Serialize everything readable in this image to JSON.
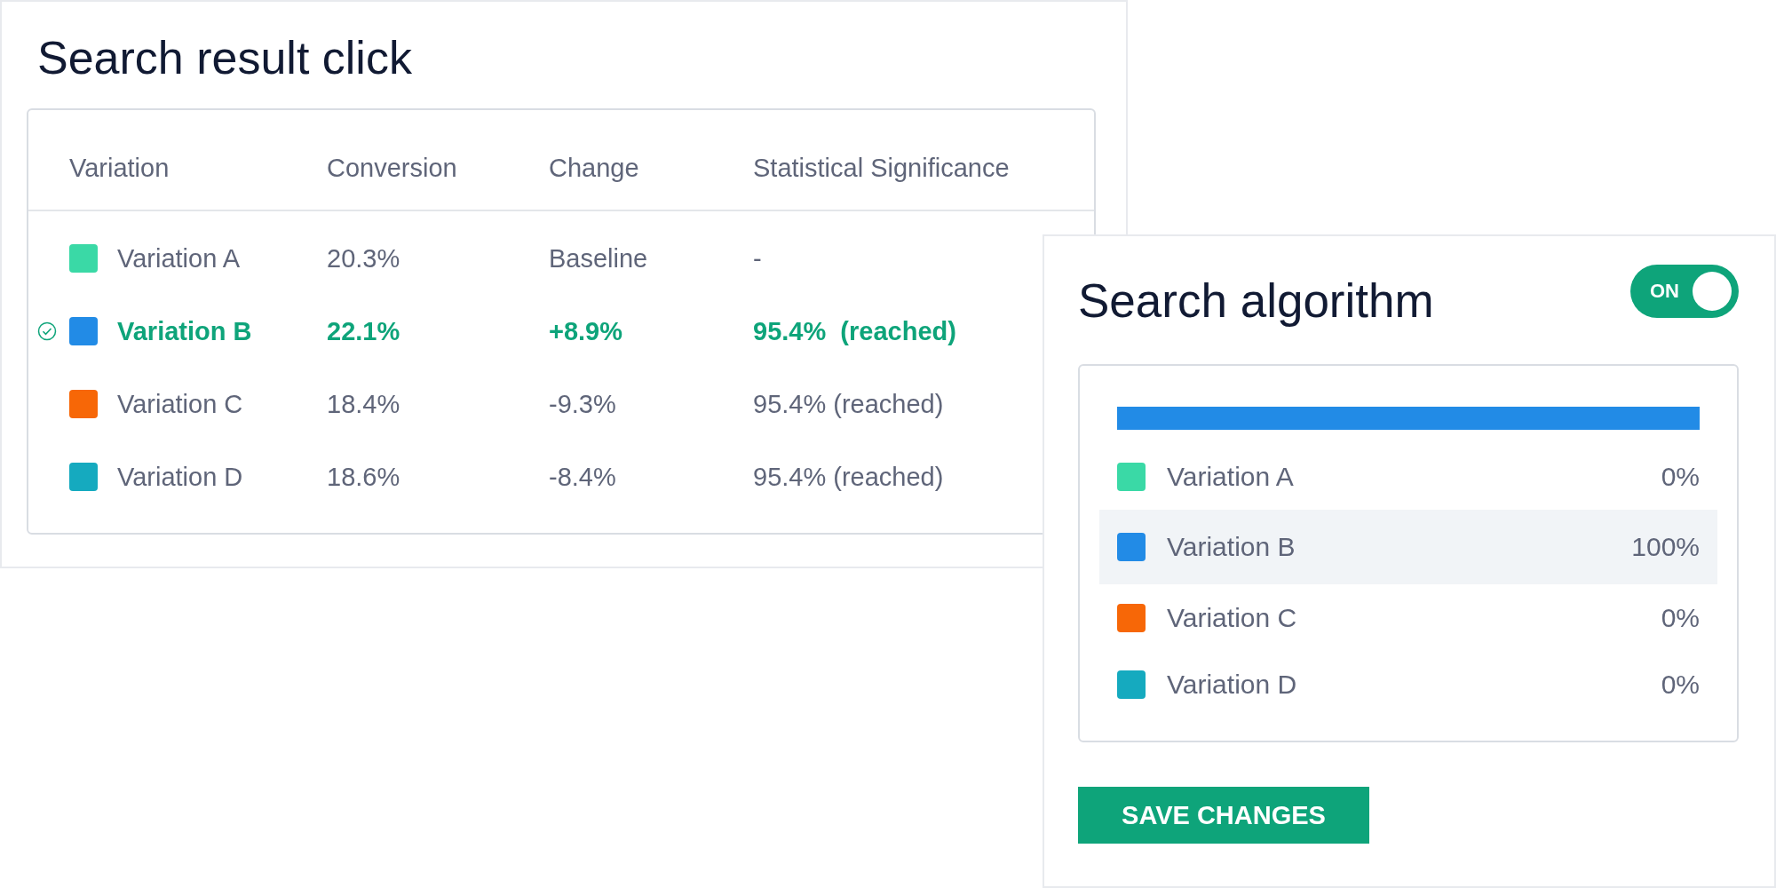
{
  "results": {
    "title": "Search result click",
    "columns": [
      "Variation",
      "Conversion",
      "Change",
      "Statistical Significance"
    ],
    "rows": [
      {
        "color": "#3ad9a6",
        "selected": false,
        "cells": [
          "Variation A",
          "20.3%",
          "Baseline",
          "-"
        ]
      },
      {
        "color": "#228be6",
        "selected": true,
        "cells": [
          "Variation B",
          "22.1%",
          "+8.9%",
          "95.4%  (reached)"
        ]
      },
      {
        "color": "#f76707",
        "selected": false,
        "cells": [
          "Variation C",
          "18.4%",
          "-9.3%",
          "95.4% (reached)"
        ]
      },
      {
        "color": "#15aabf",
        "selected": false,
        "cells": [
          "Variation D",
          "18.6%",
          "-8.4%",
          "95.4% (reached)"
        ]
      }
    ]
  },
  "allocation": {
    "title": "Search algorithm",
    "toggle": {
      "label": "ON",
      "on": true
    },
    "rows": [
      {
        "name": "Variation A",
        "color": "#3ad9a6",
        "share": "0%",
        "selected": false
      },
      {
        "name": "Variation B",
        "color": "#228be6",
        "share": "100%",
        "selected": true
      },
      {
        "name": "Variation C",
        "color": "#f76707",
        "share": "0%",
        "selected": false
      },
      {
        "name": "Variation D",
        "color": "#15aabf",
        "share": "0%",
        "selected": false
      }
    ],
    "save_button": "SAVE CHANGES"
  }
}
